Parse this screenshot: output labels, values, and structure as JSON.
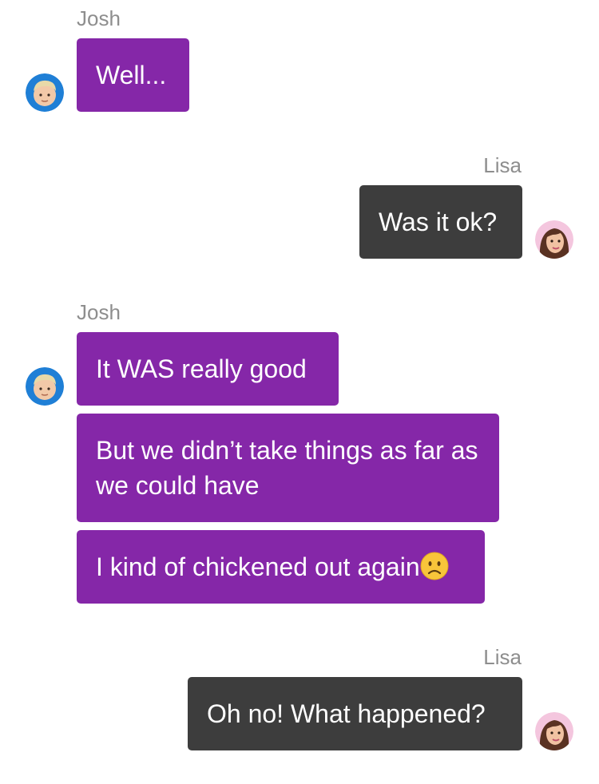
{
  "chat": {
    "groups": [
      {
        "sender": "Josh",
        "messages": [
          "Well..."
        ]
      },
      {
        "sender": "Lisa",
        "messages": [
          "Was it ok?"
        ]
      },
      {
        "sender": "Josh",
        "messages": [
          "It WAS really good",
          "But we didn’t take things as far as we could have",
          "I kind of chickened out again"
        ],
        "emoji": "slightly-frowning-face"
      },
      {
        "sender": "Lisa",
        "messages": [
          "Oh no! What happened?"
        ]
      }
    ]
  },
  "colors": {
    "josh_bubble": "#8527a8",
    "lisa_bubble": "#3d3d3d",
    "name_text": "#8e8e8e",
    "bubble_text": "#ffffff"
  },
  "icons": {
    "josh_avatar": "josh-avatar-icon",
    "lisa_avatar": "lisa-avatar-icon",
    "frown_emoji": "slightly-frowning-face-icon"
  }
}
